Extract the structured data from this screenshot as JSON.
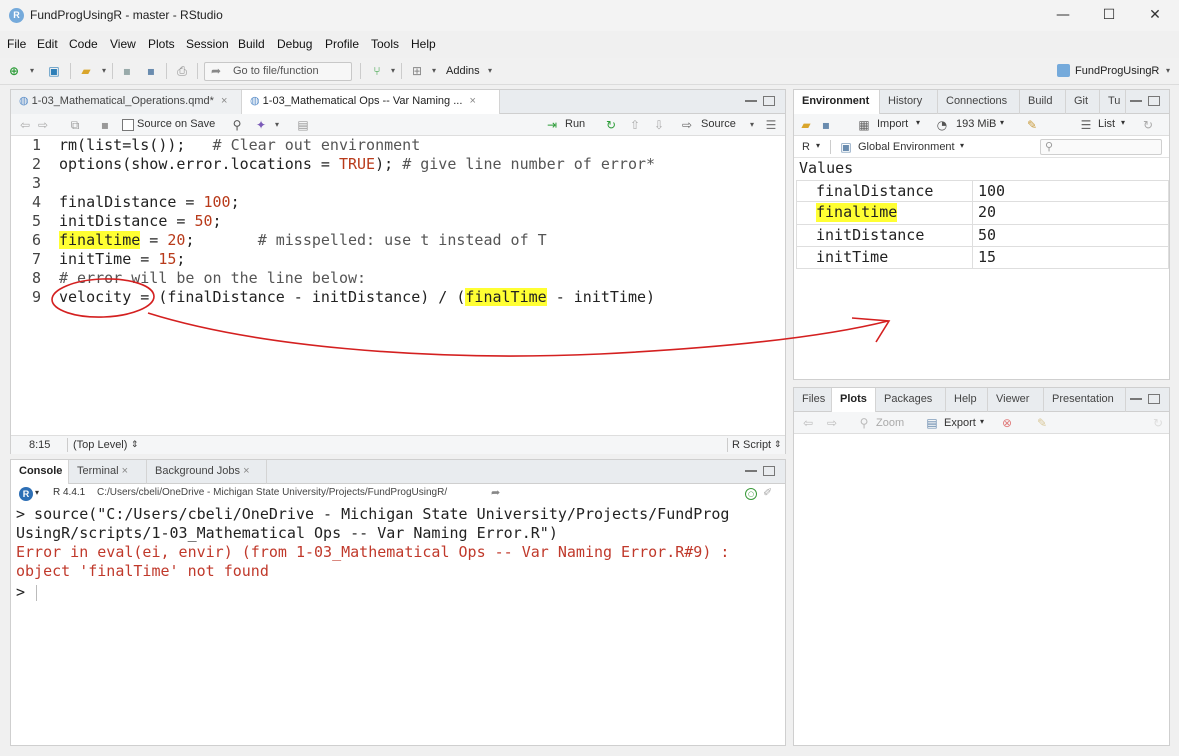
{
  "window": {
    "title": "FundProgUsingR - master - RStudio",
    "app_icon_letter": "R",
    "minimize": "—",
    "maximize": "☐",
    "close": "✕"
  },
  "menu": [
    "File",
    "Edit",
    "Code",
    "View",
    "Plots",
    "Session",
    "Build",
    "Debug",
    "Profile",
    "Tools",
    "Help"
  ],
  "toolbar": {
    "goto_placeholder": "Go to file/function",
    "addins_label": "Addins",
    "project_label": "FundProgUsingR"
  },
  "editor": {
    "tabs": [
      {
        "label": "1-03_Mathematical_Operations.qmd*"
      },
      {
        "label": "1-03_Mathematical Ops -- Var Naming ..."
      }
    ],
    "source_on_save": "Source on Save",
    "run_label": "Run",
    "source_label": "Source",
    "line_numbers": [
      "1",
      "2",
      "3",
      "4",
      "5",
      "6",
      "7",
      "8",
      "9"
    ],
    "status_position": "8:15",
    "status_scope": "(Top Level)",
    "status_type": "R Script"
  },
  "code": {
    "l1a": "rm(list=ls());   ",
    "l1c": "# Clear out environment",
    "l2a": "options(show.error.locations = ",
    "l2kw": "TRUE",
    "l2b": "); ",
    "l2c": "# give line number of error*",
    "l4a": "finalDistance = ",
    "l4n": "100",
    "l4b": ";",
    "l5a": "initDistance = ",
    "l5n": "50",
    "l5b": ";",
    "l6h": "finaltime",
    "l6a": " = ",
    "l6n": "20",
    "l6b": ";       ",
    "l6c": "# misspelled: use t instead of T",
    "l7a": "initTime = ",
    "l7n": "15",
    "l7b": ";",
    "l8c": "# error will be on the line below:",
    "l9a": "velocity = (finalDistance - initDistance) / (",
    "l9h": "finalTime",
    "l9b": " - initTime)"
  },
  "console": {
    "tabs": [
      "Console",
      "Terminal",
      "Background Jobs"
    ],
    "r_version": "R 4.4.1",
    "path": "C:/Users/cbeli/OneDrive - Michigan State University/Projects/FundProgUsingR/",
    "out1": "> source(\"C:/Users/cbeli/OneDrive - Michigan State University/Projects/FundProg",
    "out2": "UsingR/scripts/1-03_Mathematical Ops -- Var Naming Error.R\")",
    "err1": "Error in eval(ei, envir) (from 1-03_Mathematical Ops -- Var Naming Error.R#9) :",
    "err2": "object 'finalTime' not found",
    "prompt": ">"
  },
  "environment": {
    "tabs": [
      "Environment",
      "History",
      "Connections",
      "Build",
      "Git",
      "Tu"
    ],
    "import_label": "Import",
    "memory_label": "193 MiB",
    "list_label": "List",
    "lang_label": "R",
    "scope_label": "Global Environment",
    "section_label": "Values",
    "rows": [
      {
        "name": "finalDistance",
        "value": "100"
      },
      {
        "name": "finaltime",
        "value": "20"
      },
      {
        "name": "initDistance",
        "value": "50"
      },
      {
        "name": "initTime",
        "value": "15"
      }
    ]
  },
  "files": {
    "tabs": [
      "Files",
      "Plots",
      "Packages",
      "Help",
      "Viewer",
      "Presentation"
    ],
    "zoom_label": "Zoom",
    "export_label": "Export"
  },
  "colors": {
    "highlight": "#ffff33",
    "annotation": "#d42020",
    "error": "#c0392b"
  }
}
